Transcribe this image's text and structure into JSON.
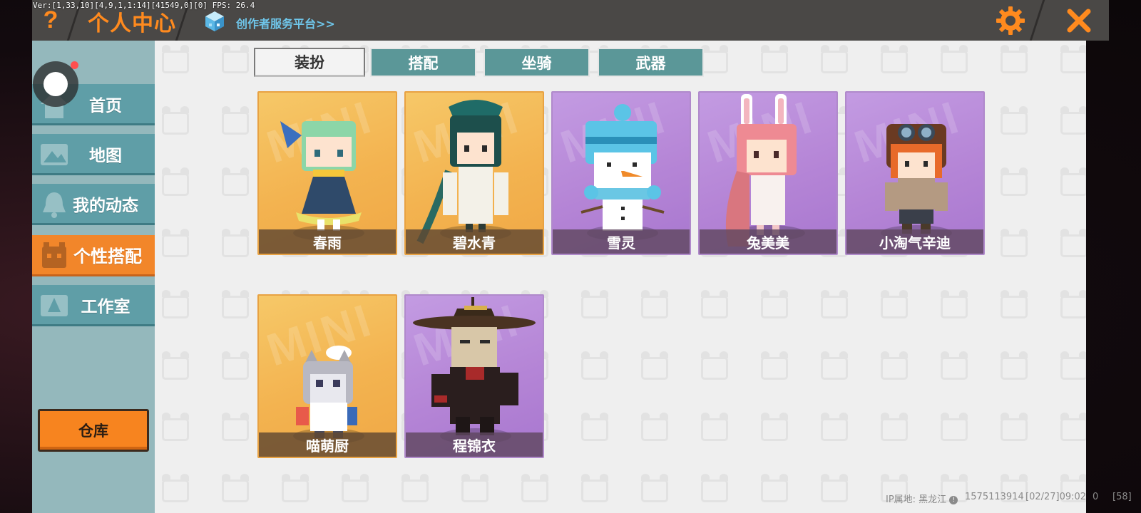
{
  "debug_text": "Ver:[1,33,10][4,9,1,1:14][41549,0][0] FPS: 26.4",
  "header": {
    "help_glyph": "?",
    "title": "个人中心",
    "creator_link": "创作者服务平台>>",
    "close_glyph": "✕"
  },
  "sidebar": {
    "items": [
      {
        "label": "首页",
        "icon": "home-icon",
        "active": false
      },
      {
        "label": "地图",
        "icon": "map-icon",
        "active": false
      },
      {
        "label": "我的动态",
        "icon": "bell-icon",
        "active": false
      },
      {
        "label": "个性搭配",
        "icon": "character-icon",
        "active": true
      },
      {
        "label": "工作室",
        "icon": "studio-icon",
        "active": false
      }
    ],
    "warehouse_label": "仓库"
  },
  "tabs": [
    {
      "label": "装扮",
      "active": true
    },
    {
      "label": "搭配",
      "active": false
    },
    {
      "label": "坐骑",
      "active": false
    },
    {
      "label": "武器",
      "active": false
    }
  ],
  "skins": [
    {
      "name": "春雨",
      "rarity_color": "gold"
    },
    {
      "name": "碧水青",
      "rarity_color": "gold"
    },
    {
      "name": "雪灵",
      "rarity_color": "purple"
    },
    {
      "name": "兔美美",
      "rarity_color": "purple"
    },
    {
      "name": "小淘气辛迪",
      "rarity_color": "purple"
    },
    {
      "name": "喵萌厨",
      "rarity_color": "gold"
    },
    {
      "name": "程锦衣",
      "rarity_color": "purple"
    }
  ],
  "card_watermark": "MINI",
  "status": {
    "ip_location": "IP属地: 黑龙江",
    "user_id": "1575113914",
    "timestamp": "[02/27]09:02",
    "extra": "0",
    "ping": "[58]"
  },
  "colors": {
    "accent_orange": "#f2862a",
    "sidebar_teal": "#5f9ea7",
    "tab_teal": "#5b9798",
    "link_blue": "#6fc6ea"
  }
}
